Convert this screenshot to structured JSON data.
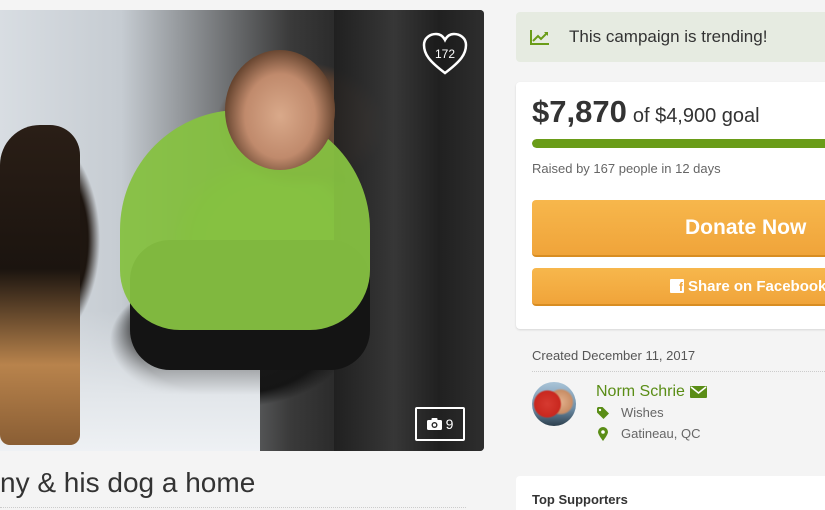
{
  "campaign": {
    "title": "ny & his dog a home",
    "heart_count": "172",
    "photo_count": "9"
  },
  "trending": {
    "icon": "trending-chart-icon",
    "text": "This campaign is trending!"
  },
  "donation": {
    "amount": "$7,870",
    "goal_text": "of $4,900 goal",
    "progress_percent": 100,
    "raised_text": "Raised by 167 people in 12 days",
    "donate_label": "Donate Now",
    "share_label": "Share on Facebook",
    "accent_color": "#f0a43a",
    "progress_color": "#6a9c18"
  },
  "organizer": {
    "created_text": "Created December 11, 2017",
    "name": "Norm Schrie",
    "category": "Wishes",
    "location": "Gatineau, QC",
    "name_color": "#5a8d16"
  },
  "supporters": {
    "heading": "Top Supporters"
  }
}
